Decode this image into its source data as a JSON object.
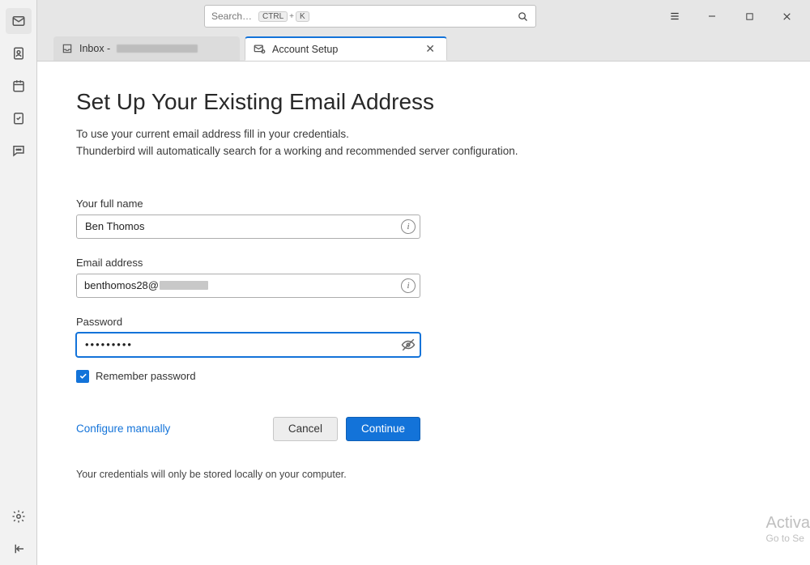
{
  "search": {
    "placeholder": "Search…",
    "kbd1": "CTRL",
    "kbd_plus": "+",
    "kbd2": "K"
  },
  "tabs": {
    "inbox": {
      "label_prefix": "Inbox - "
    },
    "setup": {
      "label": "Account Setup"
    }
  },
  "page": {
    "title": "Set Up Your Existing Email Address",
    "intro1": "To use your current email address fill in your credentials.",
    "intro2": "Thunderbird will automatically search for a working and recommended server configuration."
  },
  "form": {
    "name_label": "Your full name",
    "name_value": "Ben Thomos",
    "email_label": "Email address",
    "email_prefix": "benthomos28@",
    "password_label": "Password",
    "password_value": "•••••••••",
    "remember_label": "Remember password"
  },
  "actions": {
    "configure": "Configure manually",
    "cancel": "Cancel",
    "continue": "Continue"
  },
  "footnote": "Your credentials will only be stored locally on your computer.",
  "watermark": {
    "title": "Activa",
    "sub": "Go to Se"
  }
}
